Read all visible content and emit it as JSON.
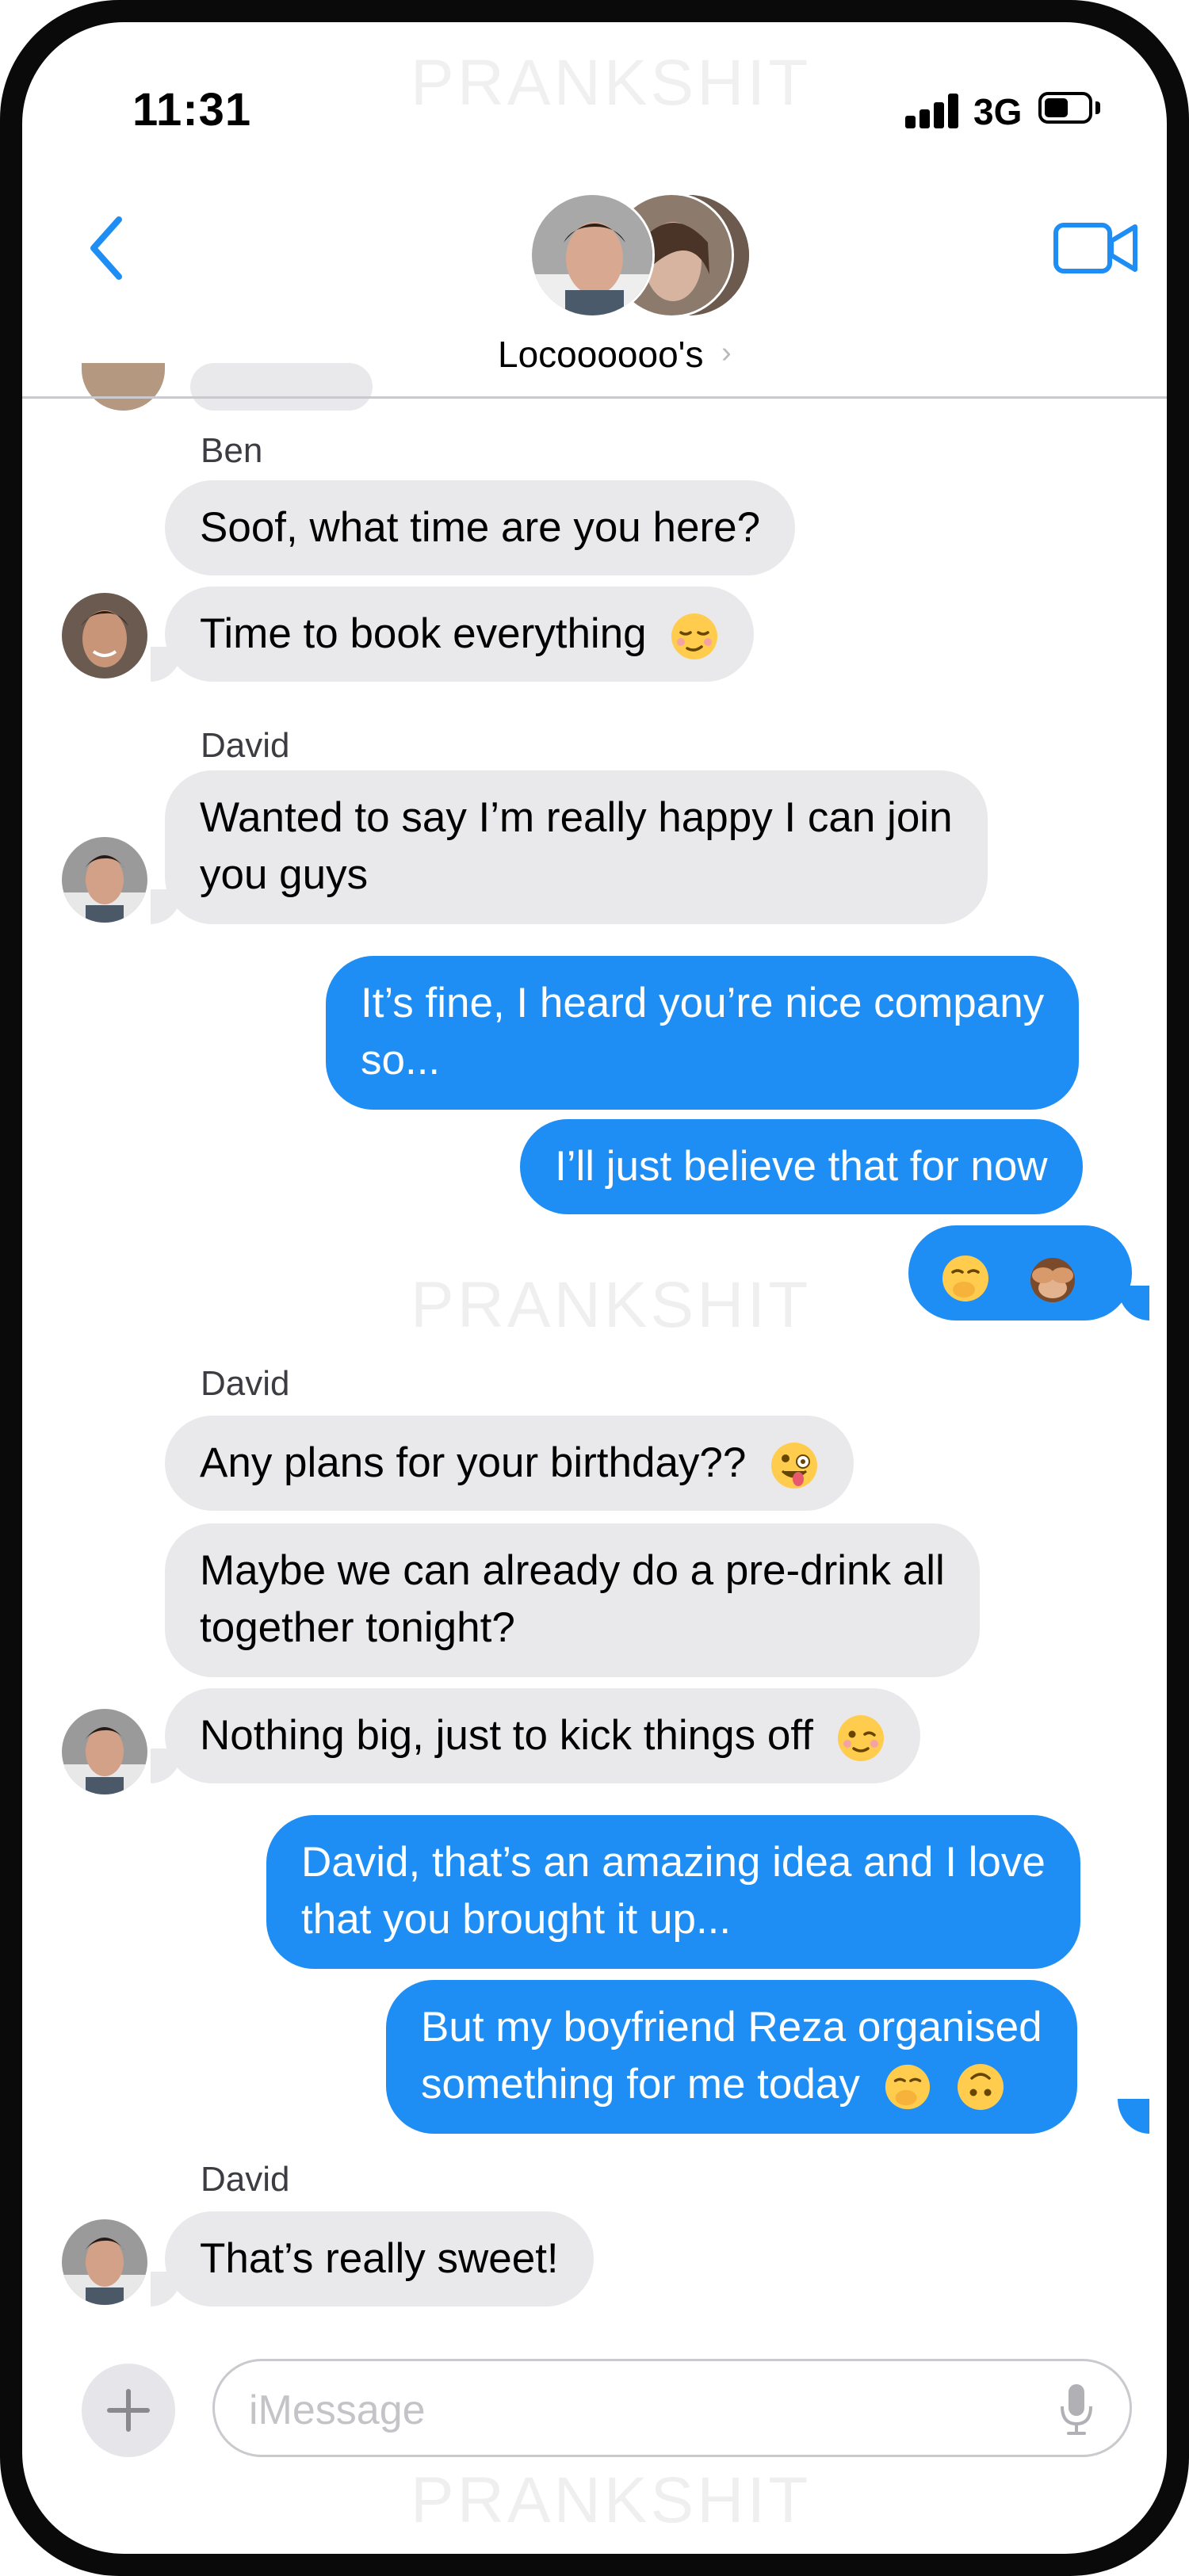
{
  "status_bar": {
    "time": "11:31",
    "network": "3G",
    "battery_fraction": 0.55
  },
  "watermark": "PRANKSHIT",
  "header": {
    "title": "Locoooooo's",
    "back_icon": "chevron-left-icon",
    "video_icon": "video-camera-icon",
    "accent_color": "#1e8ef5"
  },
  "messages": {
    "ben_sender": "Ben",
    "ben_1": "Soof, what time are you here?",
    "ben_2": "Time to book everything",
    "david_sender_1": "David",
    "david_1_line1": "Wanted to say I’m really happy I can join",
    "david_1_line2": "you guys",
    "me_1_line1": "It’s fine, I heard you’re nice company",
    "me_1_line2": "so...",
    "me_2": "I’ll just believe that for now",
    "david_sender_2": "David",
    "david_2": "Any plans for your birthday??",
    "david_3_line1": "Maybe we can already do a pre-drink all",
    "david_3_line2": "together tonight?",
    "david_4": "Nothing big, just to kick things off",
    "me_3_line1": "David, that’s an amazing idea and I love",
    "me_3_line2": "that you brought it up...",
    "me_4_line1": "But my boyfriend Reza organised",
    "me_4_line2": "something for me today",
    "david_sender_3": "David",
    "david_5": "That’s really sweet!"
  },
  "emoji": {
    "relieved": "relieved-face-emoji",
    "hand_over_mouth": "face-with-hand-over-mouth-emoji",
    "see_no_evil": "see-no-evil-monkey-emoji",
    "zany": "zany-face-emoji",
    "wink": "winking-face-emoji",
    "upside_down": "upside-down-face-emoji"
  },
  "compose": {
    "placeholder": "iMessage",
    "plus_icon": "plus-icon",
    "mic_icon": "microphone-icon"
  },
  "colors": {
    "incoming_bubble": "#e9e9eb",
    "outgoing_bubble": "#1e8ef5"
  }
}
